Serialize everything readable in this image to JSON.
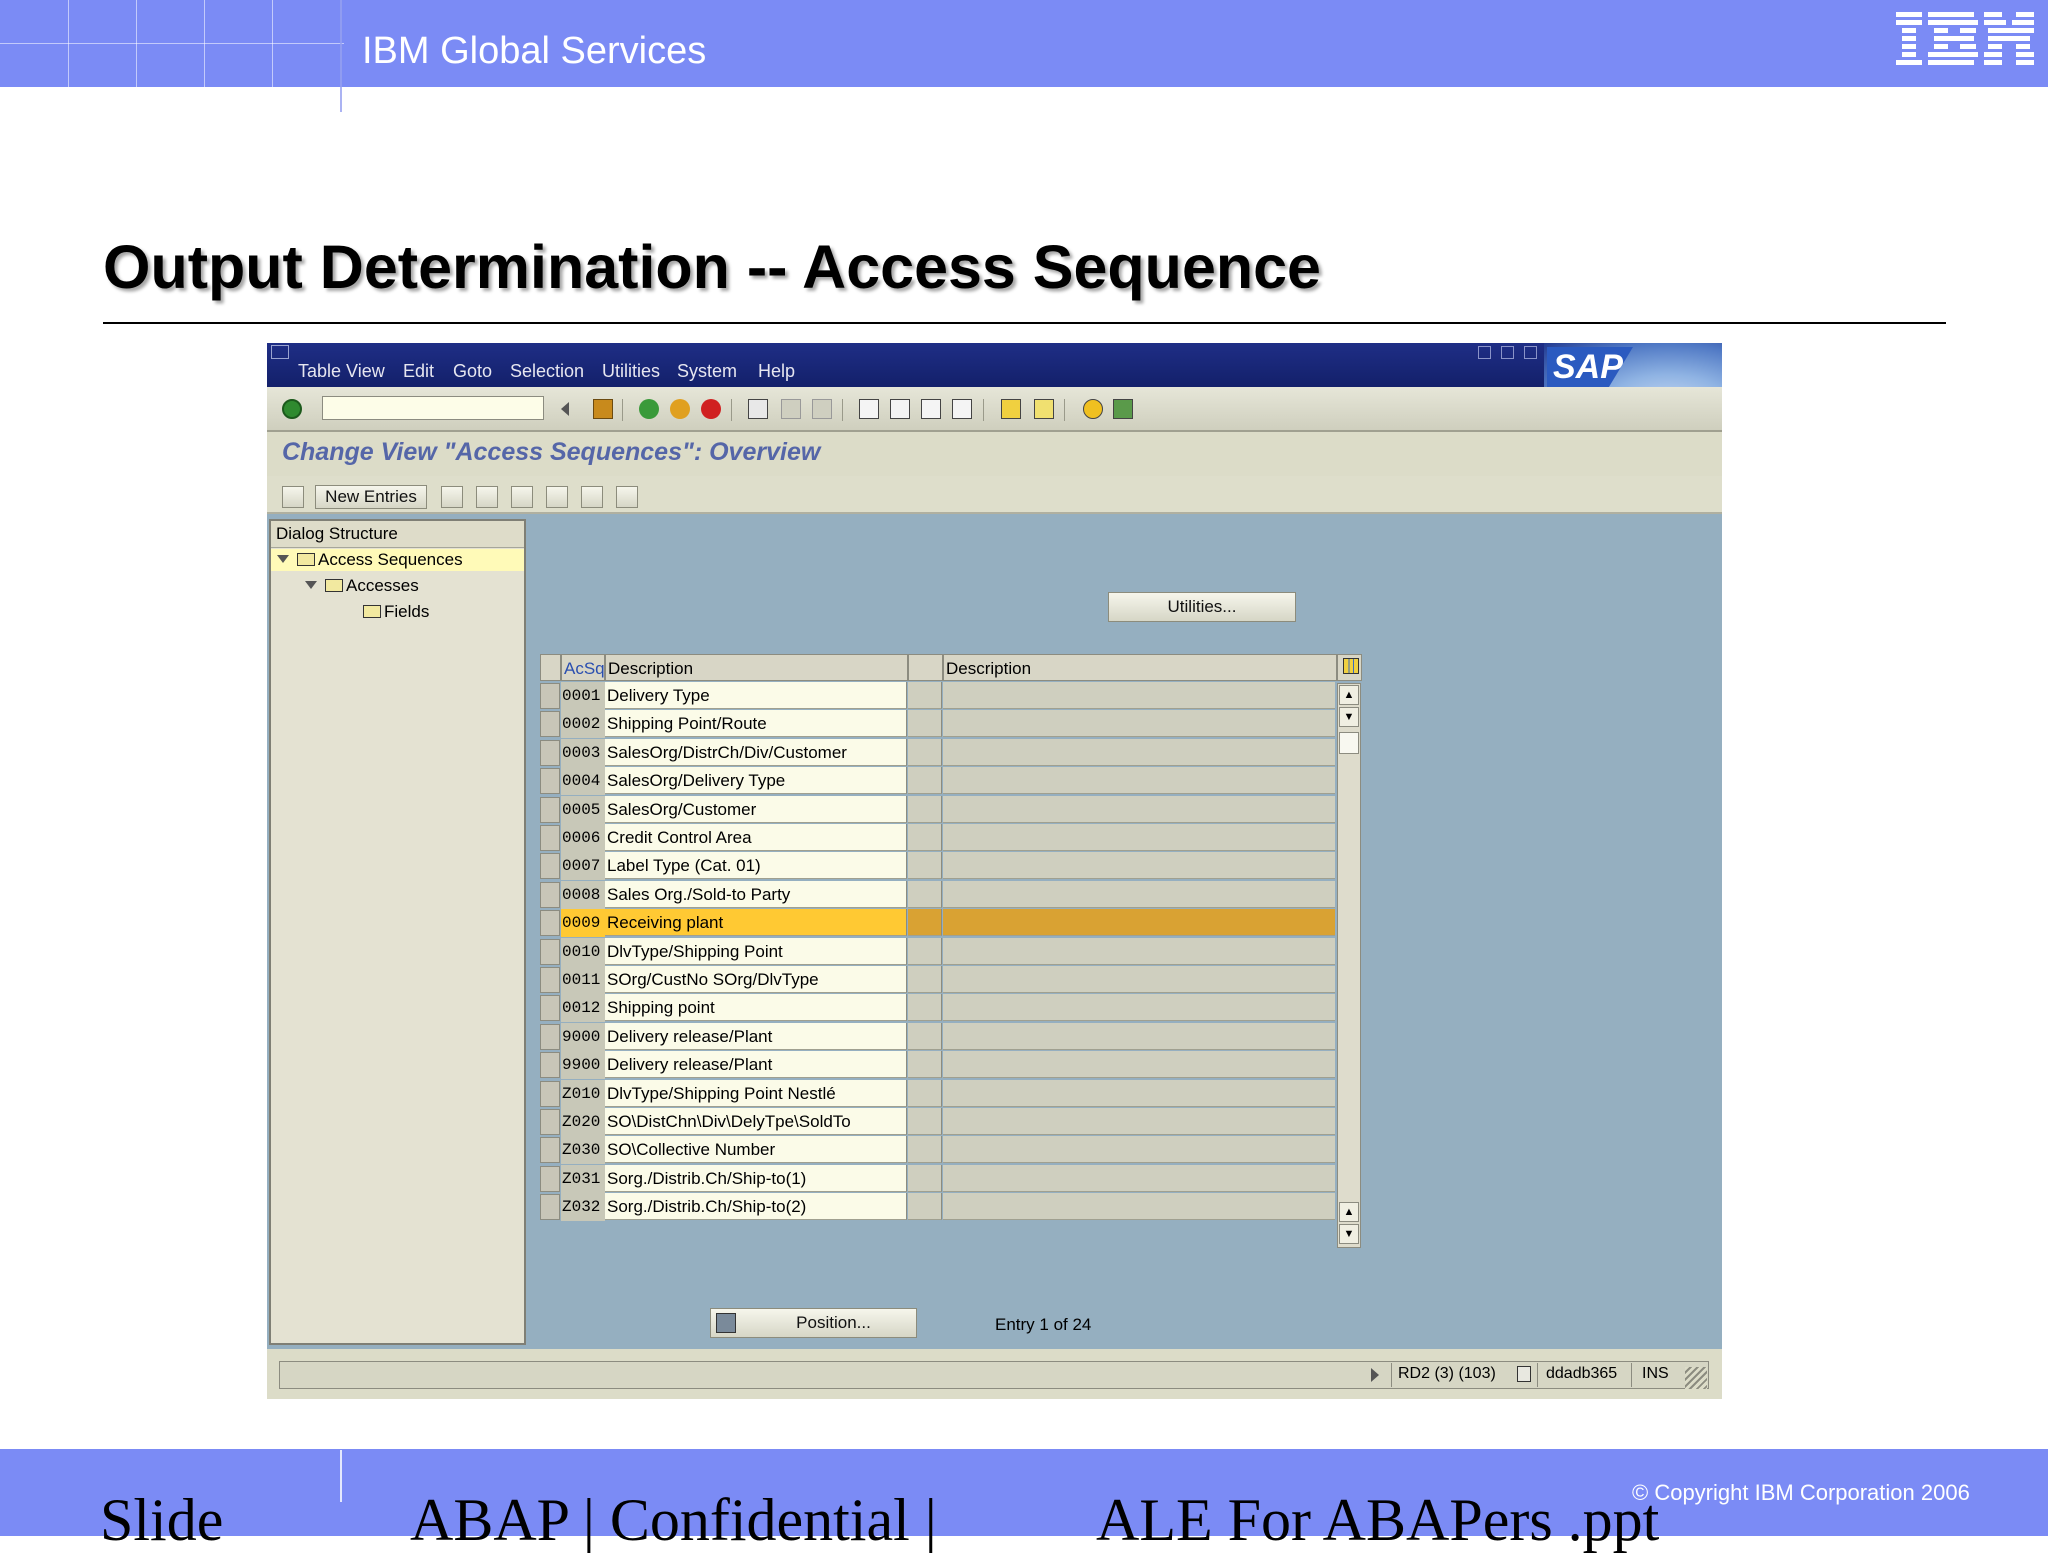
{
  "header": {
    "company": "IBM Global Services",
    "logo": "IBM"
  },
  "slide": {
    "title": "Output Determination  -- Access Sequence"
  },
  "sap": {
    "menu": [
      "Table View",
      "Edit",
      "Goto",
      "Selection",
      "Utilities",
      "System",
      "Help"
    ],
    "logo": "SAP",
    "screen_title": "Change View \"Access Sequences\": Overview",
    "new_entries_label": "New Entries",
    "dialog": {
      "header": "Dialog Structure",
      "items": [
        "Access Sequences",
        "Accesses",
        "Fields"
      ]
    },
    "utilities_button": "Utilities...",
    "table": {
      "columns": [
        "AcSq",
        "Description",
        "Description"
      ],
      "rows": [
        {
          "code": "0001",
          "desc": "Delivery Type"
        },
        {
          "code": "0002",
          "desc": "Shipping Point/Route"
        },
        {
          "code": "0003",
          "desc": "SalesOrg/DistrCh/Div/Customer"
        },
        {
          "code": "0004",
          "desc": "SalesOrg/Delivery Type"
        },
        {
          "code": "0005",
          "desc": "SalesOrg/Customer"
        },
        {
          "code": "0006",
          "desc": "Credit Control Area"
        },
        {
          "code": "0007",
          "desc": "Label Type (Cat. 01)"
        },
        {
          "code": "0008",
          "desc": "Sales Org./Sold-to Party"
        },
        {
          "code": "0009",
          "desc": "Receiving plant"
        },
        {
          "code": "0010",
          "desc": "DlvType/Shipping Point"
        },
        {
          "code": "0011",
          "desc": "SOrg/CustNo SOrg/DlvType"
        },
        {
          "code": "0012",
          "desc": "Shipping point"
        },
        {
          "code": "9000",
          "desc": "Delivery release/Plant"
        },
        {
          "code": "9900",
          "desc": "Delivery release/Plant"
        },
        {
          "code": "Z010",
          "desc": "DlvType/Shipping Point Nestlé"
        },
        {
          "code": "Z020",
          "desc": "SO\\DistChn\\Div\\DelyTpe\\SoldTo"
        },
        {
          "code": "Z030",
          "desc": "SO\\Collective Number"
        },
        {
          "code": "Z031",
          "desc": "Sorg./Distrib.Ch/Ship-to(1)"
        },
        {
          "code": "Z032",
          "desc": "Sorg./Distrib.Ch/Ship-to(2)"
        }
      ],
      "selected_code": "0009"
    },
    "position_button": "Position...",
    "entry_info": "Entry 1 of 24",
    "status": {
      "system": "RD2 (3) (103)",
      "server": "ddadb365",
      "mode": "INS"
    }
  },
  "footer": {
    "copyright": "© Copyright IBM Corporation 2006",
    "slide": "Slide",
    "confidential": "ABAP | Confidential |",
    "file": "ALE For ABAPers .ppt"
  }
}
